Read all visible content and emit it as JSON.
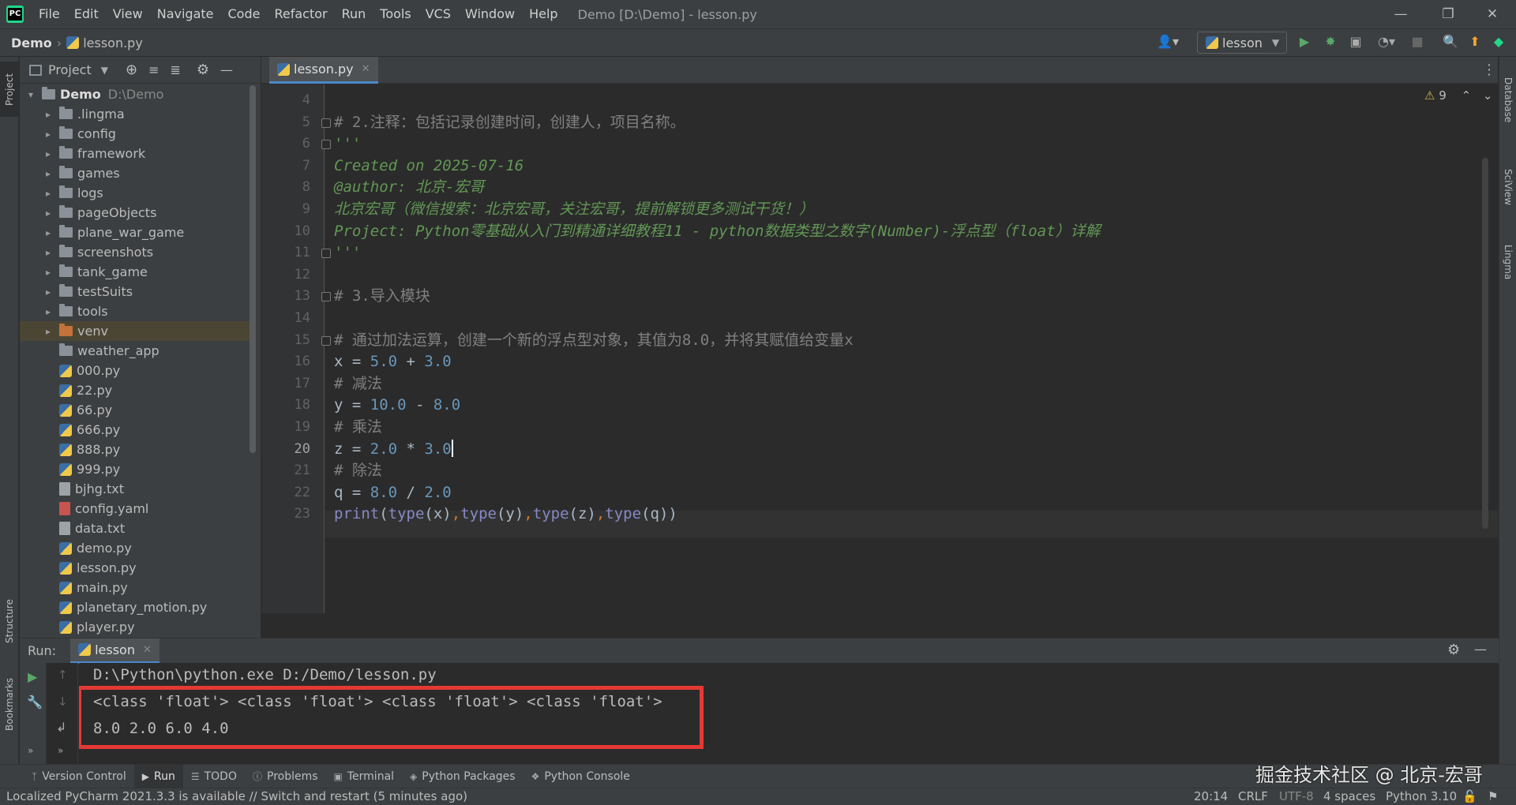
{
  "menu": [
    "File",
    "Edit",
    "View",
    "Navigate",
    "Code",
    "Refactor",
    "Run",
    "Tools",
    "VCS",
    "Window",
    "Help"
  ],
  "window_title": "Demo [D:\\Demo] - lesson.py",
  "breadcrumb": {
    "project": "Demo",
    "file": "lesson.py"
  },
  "run_config": "lesson",
  "project_panel": {
    "title": "Project",
    "root": {
      "name": "Demo",
      "path": "D:\\Demo"
    },
    "items": [
      {
        "label": ".lingma",
        "type": "folder"
      },
      {
        "label": "config",
        "type": "folder"
      },
      {
        "label": "framework",
        "type": "folder"
      },
      {
        "label": "games",
        "type": "folder"
      },
      {
        "label": "logs",
        "type": "folder"
      },
      {
        "label": "pageObjects",
        "type": "folder"
      },
      {
        "label": "plane_war_game",
        "type": "folder"
      },
      {
        "label": "screenshots",
        "type": "folder"
      },
      {
        "label": "tank_game",
        "type": "folder"
      },
      {
        "label": "testSuits",
        "type": "folder"
      },
      {
        "label": "tools",
        "type": "folder"
      },
      {
        "label": "venv",
        "type": "folder-venv"
      },
      {
        "label": "weather_app",
        "type": "folder-plain"
      },
      {
        "label": "000.py",
        "type": "py"
      },
      {
        "label": "22.py",
        "type": "py"
      },
      {
        "label": "66.py",
        "type": "py"
      },
      {
        "label": "666.py",
        "type": "py"
      },
      {
        "label": "888.py",
        "type": "py"
      },
      {
        "label": "999.py",
        "type": "py"
      },
      {
        "label": "bjhg.txt",
        "type": "txt"
      },
      {
        "label": "config.yaml",
        "type": "yml"
      },
      {
        "label": "data.txt",
        "type": "txt"
      },
      {
        "label": "demo.py",
        "type": "py"
      },
      {
        "label": "lesson.py",
        "type": "py"
      },
      {
        "label": "main.py",
        "type": "py"
      },
      {
        "label": "planetary_motion.py",
        "type": "py"
      },
      {
        "label": "player.py",
        "type": "py"
      }
    ]
  },
  "editor": {
    "tab": "lesson.py",
    "warnings": "9",
    "current_line": "20",
    "lines": [
      {
        "n": "4",
        "parts": []
      },
      {
        "n": "5",
        "parts": [
          {
            "t": "# 2.注释：包括记录创建时间，创建人，项目名称。",
            "c": "c-comment"
          }
        ]
      },
      {
        "n": "6",
        "parts": [
          {
            "t": "'''",
            "c": "c-doc"
          }
        ]
      },
      {
        "n": "7",
        "parts": [
          {
            "t": "Created on 2025-07-16",
            "c": "c-doc"
          }
        ]
      },
      {
        "n": "8",
        "parts": [
          {
            "t": "@author: 北京-宏哥",
            "c": "c-doc"
          }
        ]
      },
      {
        "n": "9",
        "parts": [
          {
            "t": "北京宏哥（微信搜索：北京宏哥，关注宏哥，提前解锁更多测试干货！）",
            "c": "c-doc"
          }
        ]
      },
      {
        "n": "10",
        "parts": [
          {
            "t": "Project: Python零基础从入门到精通详细教程11 - python数据类型之数字(Number)-浮点型（float）详解",
            "c": "c-doc"
          }
        ]
      },
      {
        "n": "11",
        "parts": [
          {
            "t": "'''",
            "c": "c-doc"
          }
        ]
      },
      {
        "n": "12",
        "parts": []
      },
      {
        "n": "13",
        "parts": [
          {
            "t": "# 3.导入模块",
            "c": "c-comment"
          }
        ]
      },
      {
        "n": "14",
        "parts": []
      },
      {
        "n": "15",
        "parts": [
          {
            "t": "# 通过加法运算，创建一个新的浮点型对象，其值为8.0，并将其赋值给变量x",
            "c": "c-comment"
          }
        ]
      },
      {
        "n": "16",
        "parts": [
          {
            "t": "x = ",
            "c": ""
          },
          {
            "t": "5.0",
            "c": "c-num"
          },
          {
            "t": " + ",
            "c": ""
          },
          {
            "t": "3.0",
            "c": "c-num"
          }
        ]
      },
      {
        "n": "17",
        "parts": [
          {
            "t": "# 减法",
            "c": "c-comment"
          }
        ]
      },
      {
        "n": "18",
        "parts": [
          {
            "t": "y = ",
            "c": ""
          },
          {
            "t": "10.0",
            "c": "c-num"
          },
          {
            "t": " - ",
            "c": ""
          },
          {
            "t": "8.0",
            "c": "c-num"
          }
        ]
      },
      {
        "n": "19",
        "parts": [
          {
            "t": "# 乘法",
            "c": "c-comment"
          }
        ]
      },
      {
        "n": "20",
        "parts": [
          {
            "t": "z = ",
            "c": ""
          },
          {
            "t": "2.0",
            "c": "c-num"
          },
          {
            "t": " * ",
            "c": ""
          },
          {
            "t": "3.0",
            "c": "c-num"
          }
        ]
      },
      {
        "n": "21",
        "parts": [
          {
            "t": "# 除法",
            "c": "c-comment"
          }
        ]
      },
      {
        "n": "22",
        "parts": [
          {
            "t": "q = ",
            "c": ""
          },
          {
            "t": "8.0",
            "c": "c-num"
          },
          {
            "t": " / ",
            "c": ""
          },
          {
            "t": "2.0",
            "c": "c-num"
          }
        ]
      },
      {
        "n": "23",
        "parts": [
          {
            "t": "print",
            "c": "c-builtin"
          },
          {
            "t": "(",
            "c": ""
          },
          {
            "t": "type",
            "c": "c-builtin"
          },
          {
            "t": "(x)",
            "c": ""
          },
          {
            "t": ",",
            "c": "c-punct"
          },
          {
            "t": "type",
            "c": "c-builtin"
          },
          {
            "t": "(y)",
            "c": ""
          },
          {
            "t": ",",
            "c": "c-punct"
          },
          {
            "t": "type",
            "c": "c-builtin"
          },
          {
            "t": "(z)",
            "c": ""
          },
          {
            "t": ",",
            "c": "c-punct"
          },
          {
            "t": "type",
            "c": "c-builtin"
          },
          {
            "t": "(q))",
            "c": ""
          }
        ]
      }
    ]
  },
  "run_panel": {
    "label": "Run:",
    "tab": "lesson",
    "console": [
      "D:\\Python\\python.exe D:/Demo/lesson.py",
      "<class 'float'> <class 'float'> <class 'float'> <class 'float'>",
      "8.0 2.0 6.0 4.0"
    ]
  },
  "side_tabs": {
    "left": [
      "Project",
      "Structure",
      "Bookmarks"
    ],
    "right": [
      "Database",
      "SciView",
      "Lingma"
    ]
  },
  "tool_tabs": [
    "Version Control",
    "Run",
    "TODO",
    "Problems",
    "Terminal",
    "Python Packages",
    "Python Console"
  ],
  "watermark": "掘金技术社区 @ 北京-宏哥",
  "status": {
    "message": "Localized PyCharm 2021.3.3 is available // Switch and restart (5 minutes ago)",
    "position": "20:14",
    "line_sep": "CRLF",
    "encoding": "UTF-8",
    "indent": "4 spaces",
    "interpreter": "Python 3.10"
  },
  "colors": {
    "accent": "#4a88c7",
    "highlight_box": "#e53935",
    "run_green": "#59a869"
  }
}
